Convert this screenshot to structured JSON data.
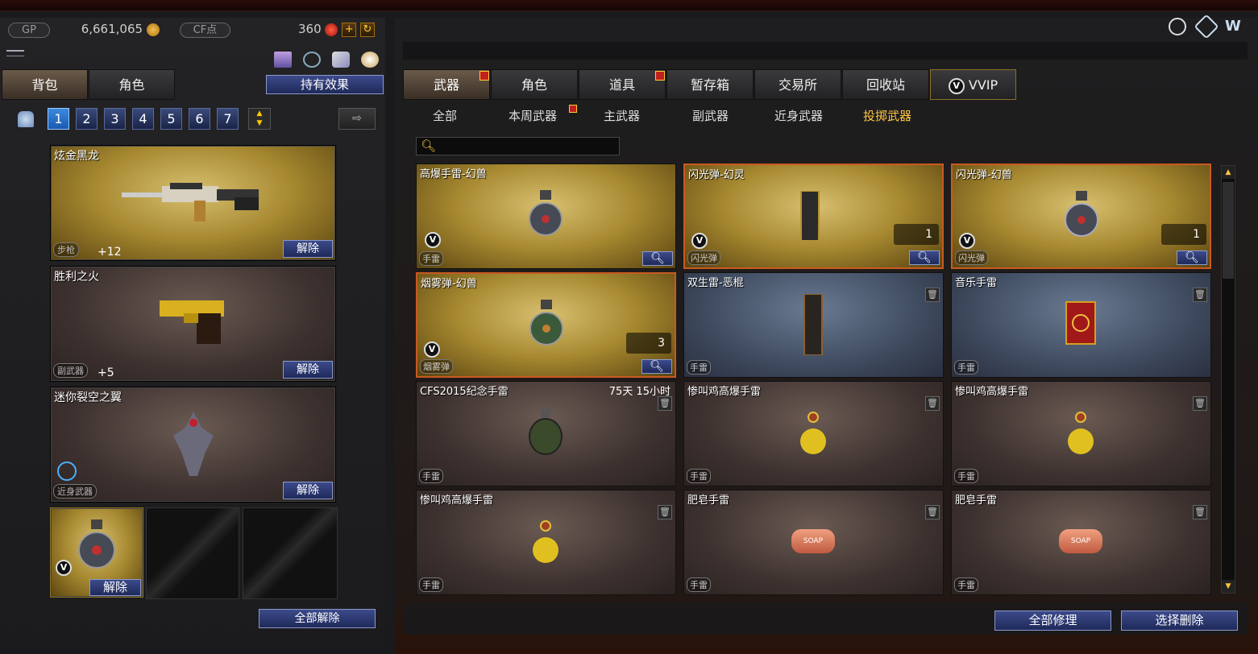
{
  "currency": {
    "gp_label": "GP",
    "gp_value": "6,661,065",
    "cf_label": "CF点",
    "cf_value": "360",
    "add_symbol": "+",
    "refresh_symbol": "↻"
  },
  "left_tabs": {
    "bag": "背包",
    "role": "角色"
  },
  "effect_button": "持有效果",
  "loadout_slots": [
    "1",
    "2",
    "3",
    "4",
    "5",
    "6",
    "7"
  ],
  "active_slot": "1",
  "equipped": [
    {
      "name": "炫金黑龙",
      "type": "步枪",
      "bonus": "+12",
      "remove": "解除"
    },
    {
      "name": "胜利之火",
      "type": "副武器",
      "bonus": "+5",
      "remove": "解除"
    },
    {
      "name": "迷你裂空之翼",
      "type": "近身武器",
      "bonus": "",
      "remove": "解除"
    }
  ],
  "small_slot_remove": "解除",
  "unequip_all": "全部解除",
  "main_tabs": [
    "武器",
    "角色",
    "道具",
    "暂存箱",
    "交易所",
    "回收站",
    "VVIP"
  ],
  "sub_tabs": [
    "全部",
    "本周武器",
    "主武器",
    "副武器",
    "近身武器",
    "投掷武器"
  ],
  "active_sub_tab": "投掷武器",
  "search_placeholder": "",
  "vip_badge": "V",
  "items": [
    {
      "name": "高爆手雷-幻兽",
      "type": "手雷",
      "timer": "",
      "count": ""
    },
    {
      "name": "闪光弹-幻灵",
      "type": "闪光弹",
      "timer": "",
      "count": "1"
    },
    {
      "name": "闪光弹-幻兽",
      "type": "闪光弹",
      "timer": "",
      "count": "1"
    },
    {
      "name": "烟雾弹-幻兽",
      "type": "烟雾弹",
      "timer": "",
      "count": "3"
    },
    {
      "name": "双生雷-恶棍",
      "type": "手雷",
      "timer": "",
      "count": ""
    },
    {
      "name": "音乐手雷",
      "type": "手雷",
      "timer": "",
      "count": ""
    },
    {
      "name": "CFS2015纪念手雷",
      "type": "手雷",
      "timer": "75天 15小时",
      "count": ""
    },
    {
      "name": "惨叫鸡高爆手雷",
      "type": "手雷",
      "timer": "",
      "count": ""
    },
    {
      "name": "惨叫鸡高爆手雷",
      "type": "手雷",
      "timer": "",
      "count": ""
    },
    {
      "name": "惨叫鸡高爆手雷",
      "type": "手雷",
      "timer": "",
      "count": ""
    },
    {
      "name": "肥皂手雷",
      "type": "手雷",
      "timer": "",
      "count": ""
    },
    {
      "name": "肥皂手雷",
      "type": "手雷",
      "timer": "",
      "count": ""
    }
  ],
  "soap_label": "SOAP",
  "repair_all": "全部修理",
  "select_delete": "选择删除",
  "colors": {
    "accent": "#ffc640",
    "selected_border": "#c85a20",
    "button_blue": "#2a3a7a"
  }
}
